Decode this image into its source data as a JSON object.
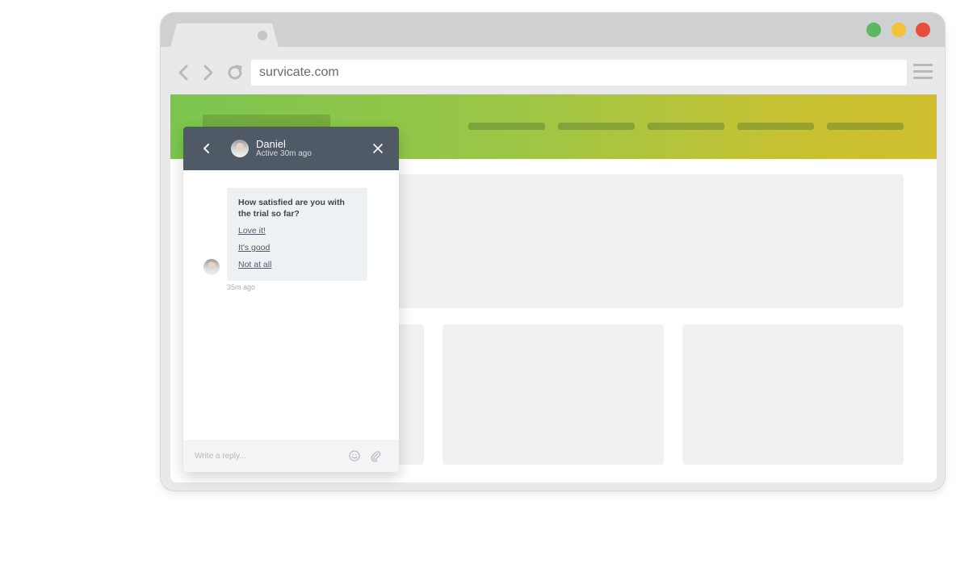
{
  "browser": {
    "url": "survicate.com",
    "traffic_colors": {
      "green": "#5cb85c",
      "yellow": "#f4c23a",
      "red": "#e74c3c"
    },
    "icons": [
      "back-arrow-icon",
      "forward-arrow-icon",
      "reload-icon",
      "hamburger-menu-icon"
    ]
  },
  "site": {
    "header_gradient": [
      "#7bc64f",
      "#d1bf2f"
    ],
    "panel_color": "#f1f1f1"
  },
  "chat": {
    "header_color": "#505a67",
    "agent_name": "Daniel",
    "agent_status": "Active 30m ago",
    "question": "How satisfied are you with the trial so far?",
    "options": [
      "Love it!",
      "It's good",
      "Not at all"
    ],
    "timestamp": "35m ago",
    "reply_placeholder": "Write a reply...",
    "icons": [
      "chevron-left-icon",
      "close-icon",
      "emoji-icon",
      "paperclip-icon"
    ]
  }
}
